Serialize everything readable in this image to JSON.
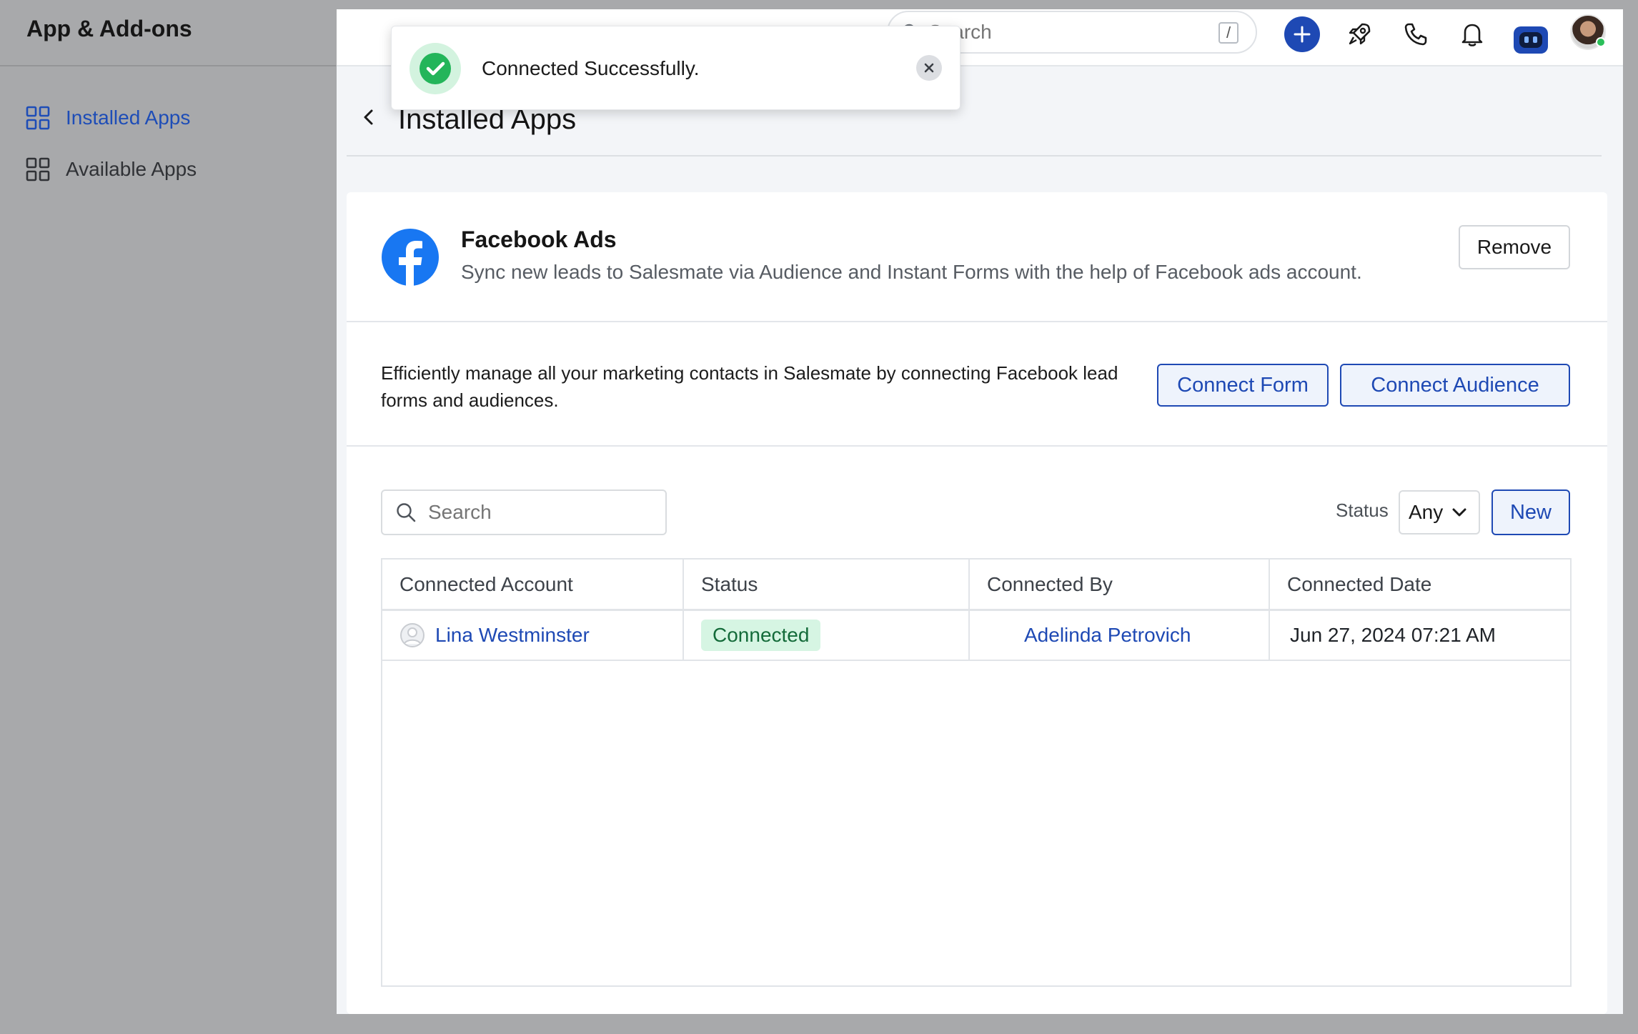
{
  "left_panel": {
    "title": "App & Add-ons",
    "nav": [
      {
        "label": "Installed Apps",
        "active": true
      },
      {
        "label": "Available Apps",
        "active": false
      }
    ]
  },
  "topbar": {
    "search_placeholder": "Search",
    "search_shortcut": "/",
    "icons": [
      "plus-icon",
      "rocket-icon",
      "phone-icon",
      "bell-icon",
      "bot-icon",
      "user-avatar"
    ]
  },
  "toast": {
    "message": "Connected Successfully.",
    "icon": "check-circle-icon"
  },
  "page": {
    "title": "Installed Apps"
  },
  "app": {
    "name": "Facebook Ads",
    "description": "Sync new leads to Salesmate via Audience and Instant Forms with the help of Facebook ads account.",
    "remove_label": "Remove",
    "info_text": "Efficiently manage all your marketing contacts in Salesmate by connecting Facebook lead forms and audiences.",
    "connect_form_label": "Connect Form",
    "connect_audience_label": "Connect Audience"
  },
  "filters": {
    "search_placeholder": "Search",
    "status_label": "Status",
    "status_value": "Any",
    "new_label": "New"
  },
  "table": {
    "columns": [
      "Connected Account",
      "Status",
      "Connected By",
      "Connected Date"
    ],
    "rows": [
      {
        "account": "Lina Westminster",
        "status": "Connected",
        "connected_by": "Adelinda Petrovich",
        "date": "Jun 27, 2024 07:21 AM"
      }
    ]
  },
  "colors": {
    "accent": "#1e49b4",
    "success": "#2bbf5a",
    "badge_bg": "#d6f5e3",
    "backdrop": "#a8a9ab"
  }
}
